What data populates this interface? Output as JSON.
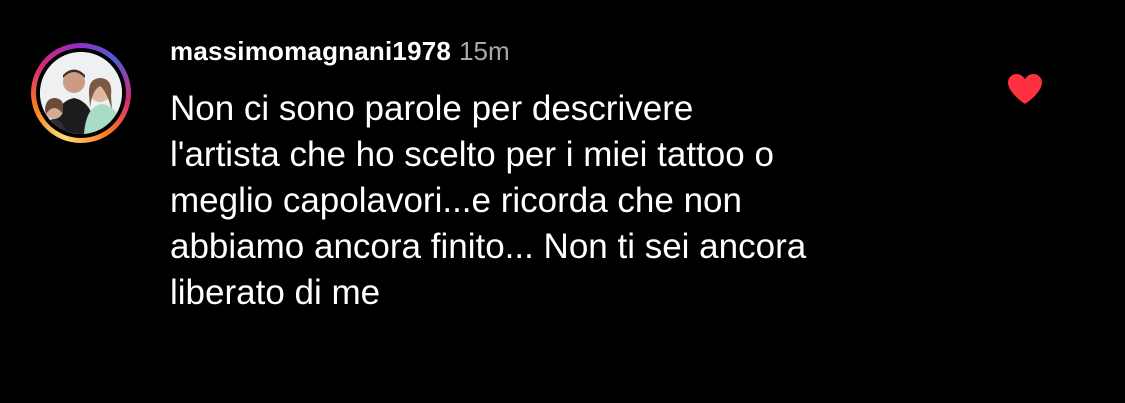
{
  "comment": {
    "username": "massimomagnani1978",
    "timestamp": "15m",
    "text_lines": [
      "Non ci sono parole per descrivere",
      "l'artista che ho scelto per i miei tattoo o",
      "meglio capolavori...e ricorda che non",
      "abbiamo ancora finito... Non ti sei ancora",
      "liberato di me"
    ],
    "liked": true,
    "icons": {
      "avatar": "profile-photo-icon",
      "like": "heart-filled-icon"
    },
    "colors": {
      "background": "#000000",
      "text": "#ffffff",
      "timestamp": "#a8a8a8",
      "heart": "#ff3040"
    }
  }
}
